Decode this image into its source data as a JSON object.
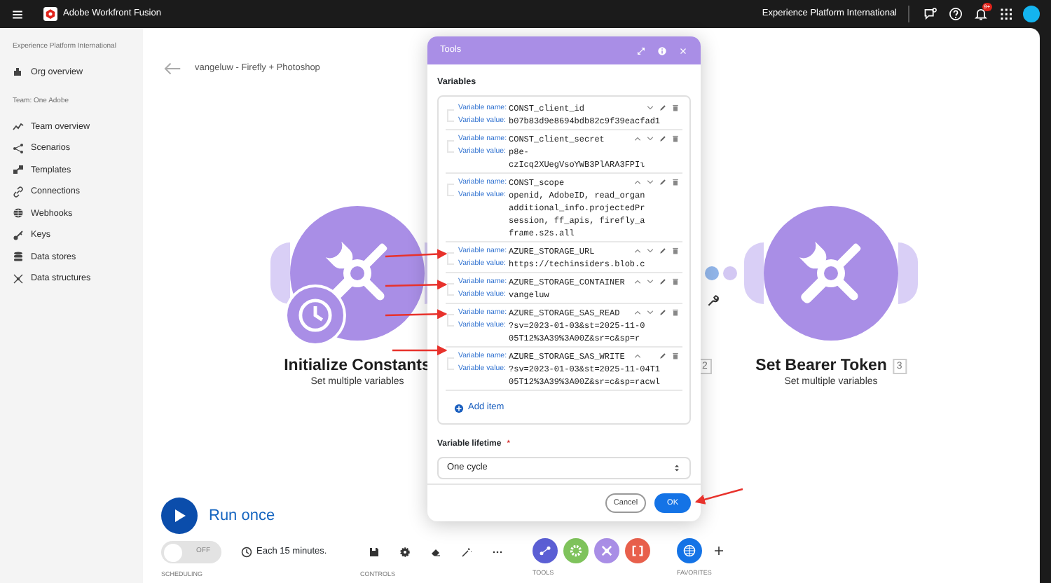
{
  "topbar": {
    "app_name": "Adobe Workfront Fusion",
    "org": "Experience Platform International",
    "notification_badge": "9+"
  },
  "sidebar": {
    "org_label": "Experience Platform International",
    "org_items": [
      {
        "kind": "org",
        "label": "Org overview"
      }
    ],
    "team_label": "Team: One Adobe",
    "team_items": [
      {
        "kind": "team",
        "label": "Team overview"
      },
      {
        "kind": "scenarios",
        "label": "Scenarios"
      },
      {
        "kind": "templates",
        "label": "Templates"
      },
      {
        "kind": "connections",
        "label": "Connections"
      },
      {
        "kind": "webhooks",
        "label": "Webhooks"
      },
      {
        "kind": "keys",
        "label": "Keys"
      },
      {
        "kind": "datastores",
        "label": "Data stores"
      },
      {
        "kind": "datastructures",
        "label": "Data structures"
      }
    ]
  },
  "scenario": {
    "title": "vangeluw - Firefly + Photoshop",
    "modules": [
      {
        "kind": "visible",
        "title": "Initialize Constants",
        "subtitle": "Set multiple variables",
        "clock_badge": true
      },
      {
        "kind": "hidden",
        "number": "2"
      },
      {
        "kind": "visible",
        "title": "Set Bearer Token",
        "subtitle": "Set multiple variables",
        "number": "3",
        "clock_badge": false
      }
    ]
  },
  "footer": {
    "run_label": "Run once",
    "scheduling": {
      "on": false,
      "toggle_text": "OFF",
      "interval": "Each 15 minutes.",
      "label": "SCHEDULING"
    },
    "controls_label": "CONTROLS",
    "tools": {
      "label": "TOOLS",
      "items": [
        {
          "kind": "flow",
          "color": "#5b5fd4"
        },
        {
          "kind": "gear",
          "color": "#7fc35c"
        },
        {
          "kind": "tools",
          "color": "#a98ee6"
        },
        {
          "kind": "brackets",
          "color": "#e8604c"
        }
      ]
    },
    "favorites_label": "FAVORITES"
  },
  "dialog": {
    "title": "Tools",
    "section": "Variables",
    "variables": [
      {
        "name_label": "Variable name:",
        "name": "CONST_client_id",
        "value_label": "Variable value:",
        "value_lines": [
          "b07b83d9e8694bdb82c9f39eacfad1"
        ],
        "up": false,
        "down": true
      },
      {
        "name_label": "Variable name:",
        "name": "CONST_client_secret",
        "value_label": "Variable value:",
        "value_lines": [
          "p8e-",
          "czIcq2XUegVsoYWB3PlARA3FPIι"
        ],
        "up": true,
        "down": true
      },
      {
        "name_label": "Variable name:",
        "name": "CONST_scope",
        "value_label": "Variable value:",
        "value_lines": [
          "openid, AdobeID, read_organ",
          "additional_info.projectedPr",
          "session, ff_apis, firefly_a",
          "frame.s2s.all"
        ],
        "up": true,
        "down": true
      },
      {
        "name_label": "Variable name:",
        "name": "AZURE_STORAGE_URL",
        "value_label": "Variable value:",
        "value_lines": [
          "https://techinsiders.blob.c"
        ],
        "up": true,
        "down": true
      },
      {
        "name_label": "Variable name:",
        "name": "AZURE_STORAGE_CONTAINER",
        "value_label": "Variable value:",
        "value_lines": [
          "vangeluw"
        ],
        "up": true,
        "down": true
      },
      {
        "name_label": "Variable name:",
        "name": "AZURE_STORAGE_SAS_READ",
        "value_label": "Variable value:",
        "value_lines": [
          "?sv=2023-01-03&st=2025-11-0",
          "05T12%3A39%3A00Z&sr=c&sp=r"
        ],
        "up": true,
        "down": true
      },
      {
        "name_label": "Variable name:",
        "name": "AZURE_STORAGE_SAS_WRITE",
        "value_label": "Variable value:",
        "value_lines": [
          "?sv=2023-01-03&st=2025-11-04T1",
          "05T12%3A39%3A00Z&sr=c&sp=racwl"
        ],
        "up": true,
        "down": false
      }
    ],
    "add_item": "Add item",
    "lifetime_label": "Variable lifetime",
    "required_mark": "*",
    "lifetime_value": "One cycle",
    "cancel": "Cancel",
    "ok": "OK"
  }
}
